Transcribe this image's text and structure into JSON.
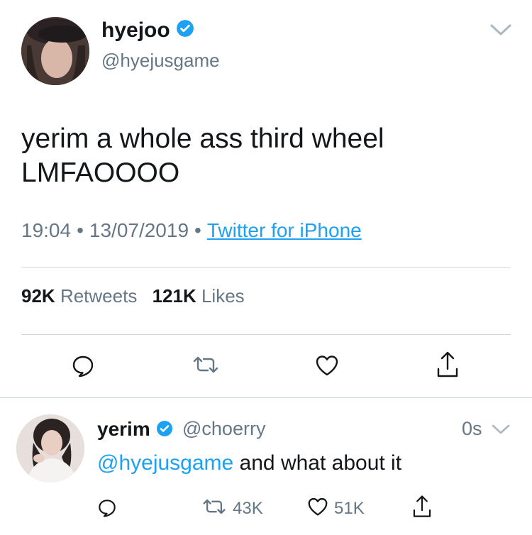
{
  "main_tweet": {
    "display_name": "hyejoo",
    "handle": "@hyejusgame",
    "text_line1": "yerim a whole ass third wheel",
    "text_line2": "LMFAOOOO",
    "time": "19:04",
    "date": "13/07/2019",
    "source": "Twitter for iPhone",
    "retweets_count": "92K",
    "retweets_label": "Retweets",
    "likes_count": "121K",
    "likes_label": "Likes"
  },
  "reply": {
    "display_name": "yerim",
    "handle": "@choerry",
    "time": "0s",
    "mention": "@hyejusgame",
    "text": " and what about it",
    "retweets_count": "43K",
    "likes_count": "51K"
  },
  "icons": {
    "verified": "verified-badge-icon",
    "caret": "chevron-down-icon",
    "reply": "reply-icon",
    "retweet": "retweet-icon",
    "like": "heart-icon",
    "share": "share-icon"
  },
  "colors": {
    "accent": "#1da1f2",
    "secondary_text": "#657786",
    "divider": "#ccd6dd"
  }
}
